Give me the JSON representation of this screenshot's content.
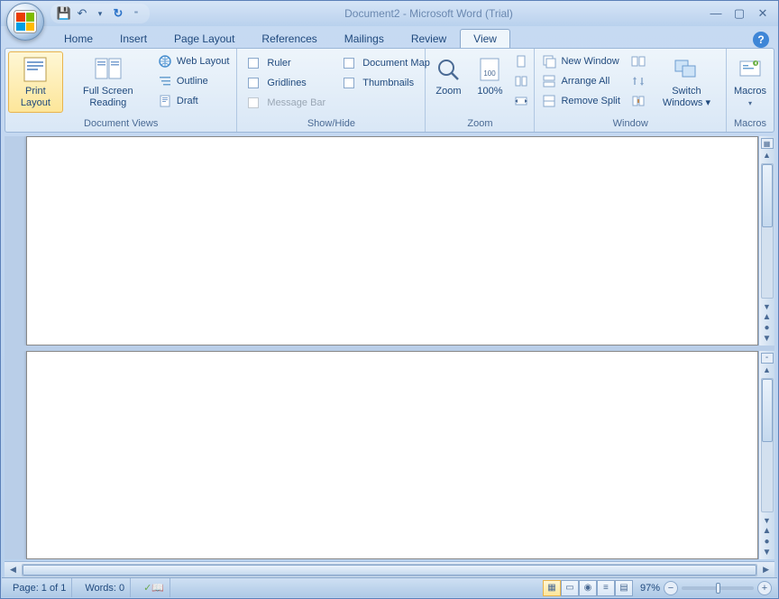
{
  "title": "Document2 - Microsoft Word (Trial)",
  "qat": {
    "save": "💾",
    "undo": "↶",
    "redo": "↻",
    "dd": "▾",
    "more": "⁼"
  },
  "tabs": [
    "Home",
    "Insert",
    "Page Layout",
    "References",
    "Mailings",
    "Review",
    "View"
  ],
  "active_tab": 6,
  "ribbon": {
    "group1": {
      "label": "Document Views",
      "print_layout": "Print Layout",
      "full_screen": "Full Screen Reading",
      "web_layout": "Web Layout",
      "outline": "Outline",
      "draft": "Draft"
    },
    "group2": {
      "label": "Show/Hide",
      "ruler": "Ruler",
      "gridlines": "Gridlines",
      "message_bar": "Message Bar",
      "document_map": "Document Map",
      "thumbnails": "Thumbnails"
    },
    "group3": {
      "label": "Zoom",
      "zoom": "Zoom",
      "hundred": "100%"
    },
    "group4": {
      "label": "Window",
      "new_window": "New Window",
      "arrange_all": "Arrange All",
      "remove_split": "Remove Split",
      "switch": "Switch Windows ▾"
    },
    "group5": {
      "label": "Macros",
      "macros": "Macros"
    }
  },
  "status": {
    "page": "Page: 1 of 1",
    "words": "Words: 0",
    "zoom_pct": "97%"
  }
}
